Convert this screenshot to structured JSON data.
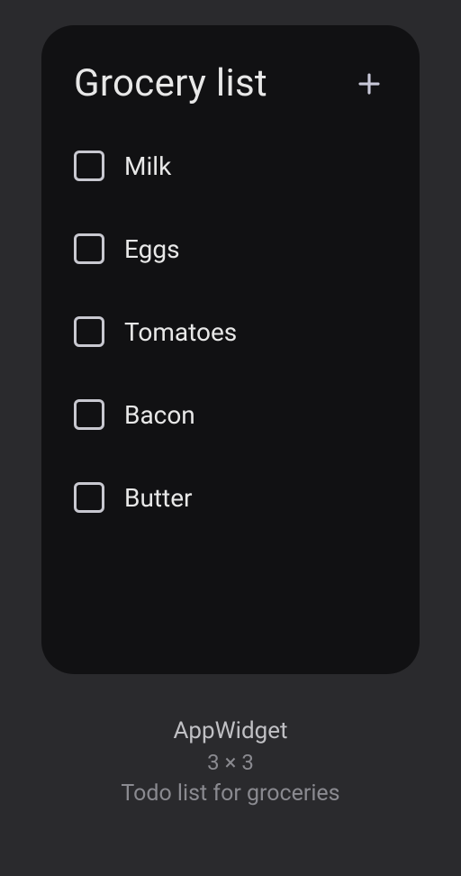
{
  "widget": {
    "title": "Grocery list",
    "items": [
      {
        "label": "Milk"
      },
      {
        "label": "Eggs"
      },
      {
        "label": "Tomatoes"
      },
      {
        "label": "Bacon"
      },
      {
        "label": "Butter"
      }
    ]
  },
  "info": {
    "title": "AppWidget",
    "size": "3 × 3",
    "description": "Todo list for groceries"
  }
}
